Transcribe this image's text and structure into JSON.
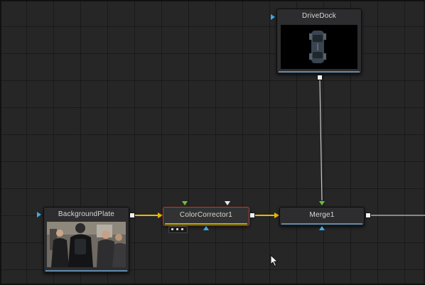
{
  "nodes": {
    "drivedock": {
      "title": "DriveDock",
      "icon": "car-thumbnail-icon"
    },
    "background_plate": {
      "title": "BackgroundPlate",
      "icon": "people-thumbnail-icon"
    },
    "color_corrector": {
      "title": "ColorCorrector1"
    },
    "merge": {
      "title": "Merge1"
    }
  },
  "colors": {
    "background": "#262626",
    "grid": "#1c1c1c",
    "node": "#2d2d2f",
    "selected_outline": "#c0392b",
    "wire_image": "#e8b800",
    "wire_plain": "#c8c8c8",
    "input_main": "#3fa7e8",
    "input_background": "#6bc23c",
    "output_port": "#f2f2f2",
    "node_underline": "#5e86a6"
  }
}
